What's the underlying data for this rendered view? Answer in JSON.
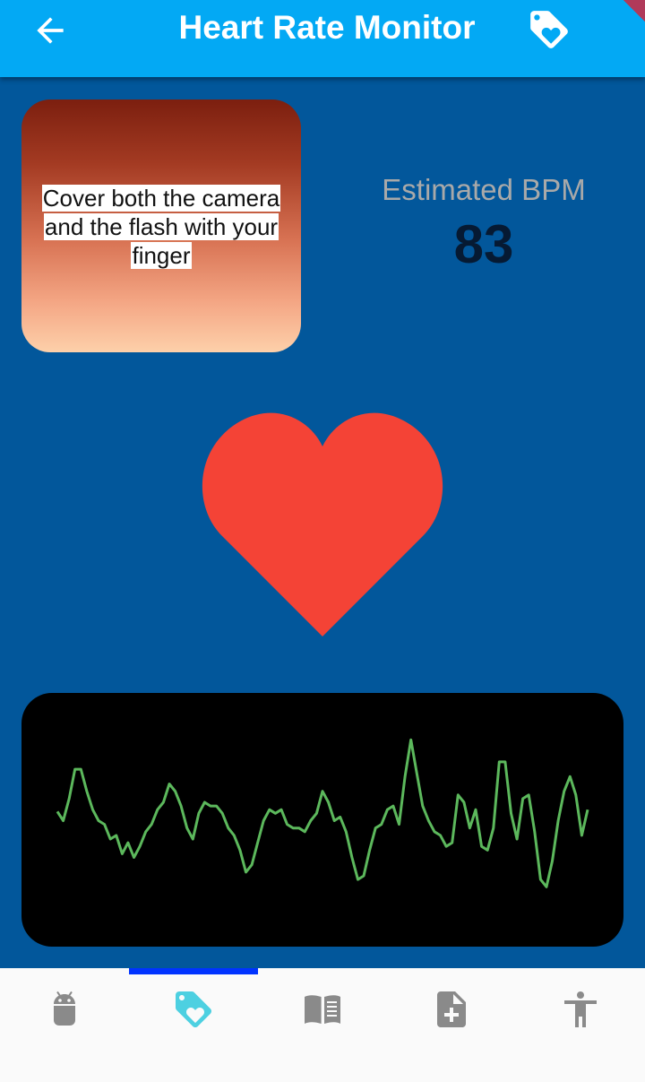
{
  "app_bar": {
    "title": "Heart Rate Monitor",
    "back_icon": "arrow-back-icon",
    "action_icon": "loyalty-tag-heart-icon",
    "background": "#03a9f4"
  },
  "camera_preview": {
    "hint": "Cover both the camera and the flash with your finger"
  },
  "bpm": {
    "label": "Estimated BPM",
    "value": "83"
  },
  "heart_icon": {
    "name": "heart-icon",
    "color": "#f44336"
  },
  "graph": {
    "line_color": "#5cb85c",
    "background": "#000000",
    "signal": [
      0.55,
      0.5,
      0.62,
      0.78,
      0.78,
      0.66,
      0.56,
      0.5,
      0.48,
      0.4,
      0.42,
      0.32,
      0.38,
      0.3,
      0.36,
      0.44,
      0.48,
      0.56,
      0.6,
      0.7,
      0.66,
      0.58,
      0.46,
      0.4,
      0.54,
      0.6,
      0.58,
      0.58,
      0.54,
      0.46,
      0.42,
      0.34,
      0.22,
      0.26,
      0.38,
      0.5,
      0.56,
      0.54,
      0.56,
      0.48,
      0.46,
      0.46,
      0.44,
      0.5,
      0.54,
      0.66,
      0.6,
      0.5,
      0.52,
      0.44,
      0.3,
      0.18,
      0.2,
      0.34,
      0.46,
      0.48,
      0.56,
      0.58,
      0.48,
      0.74,
      0.94,
      0.76,
      0.58,
      0.5,
      0.44,
      0.42,
      0.36,
      0.38,
      0.64,
      0.6,
      0.46,
      0.56,
      0.36,
      0.34,
      0.46,
      0.82,
      0.82,
      0.54,
      0.4,
      0.62,
      0.64,
      0.44,
      0.18,
      0.14,
      0.28,
      0.5,
      0.66,
      0.74,
      0.64,
      0.42,
      0.56
    ]
  },
  "bottom_nav": {
    "items": [
      {
        "icon": "android-icon",
        "active": false
      },
      {
        "icon": "tag-heart-icon",
        "active": true
      },
      {
        "icon": "book-icon",
        "active": false
      },
      {
        "icon": "note-add-icon",
        "active": false
      },
      {
        "icon": "accessibility-icon",
        "active": false
      }
    ],
    "active_color": "#4dd0e1",
    "inactive_color": "#8a8a8a",
    "indicator_color": "#0033ff"
  }
}
